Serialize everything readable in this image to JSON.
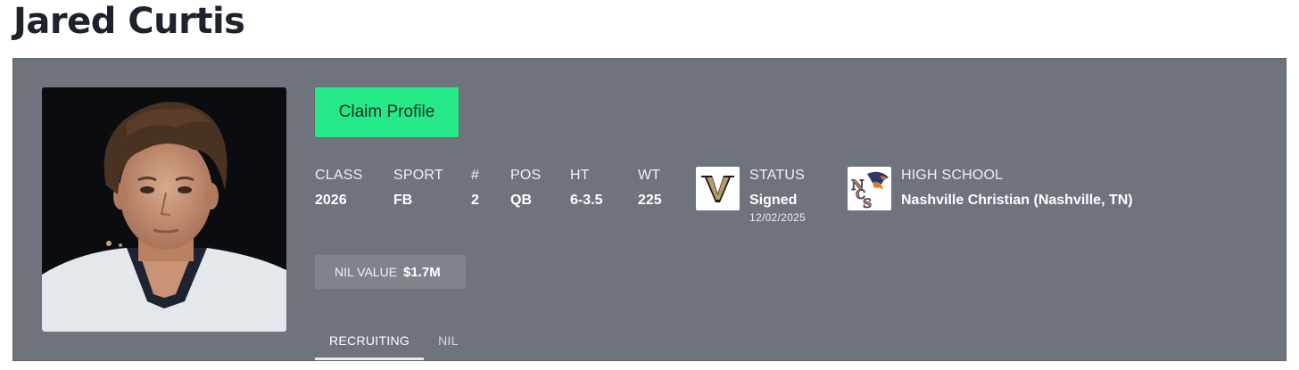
{
  "player": {
    "name": "Jared Curtis"
  },
  "actions": {
    "claim_label": "Claim Profile"
  },
  "stats": [
    {
      "label": "CLASS",
      "value": "2026"
    },
    {
      "label": "SPORT",
      "value": "FB"
    },
    {
      "label": "#",
      "value": "2"
    },
    {
      "label": "POS",
      "value": "QB"
    },
    {
      "label": "HT",
      "value": "6-3.5"
    },
    {
      "label": "WT",
      "value": "225"
    }
  ],
  "status": {
    "label": "STATUS",
    "value": "Signed",
    "date": "12/02/2025",
    "logo_icon": "vanderbilt-v-logo"
  },
  "high_school": {
    "label": "HIGH SCHOOL",
    "value": "Nashville Christian (Nashville, TN)",
    "logo_icon": "ncs-eagle-logo"
  },
  "nil": {
    "label": "NIL VALUE",
    "value": "$1.7M"
  },
  "tabs": [
    {
      "label": "RECRUITING",
      "active": true
    },
    {
      "label": "NIL",
      "active": false
    }
  ],
  "colors": {
    "panel": "#6f737b",
    "claim_button": "#25e888",
    "title": "#1c232d"
  }
}
